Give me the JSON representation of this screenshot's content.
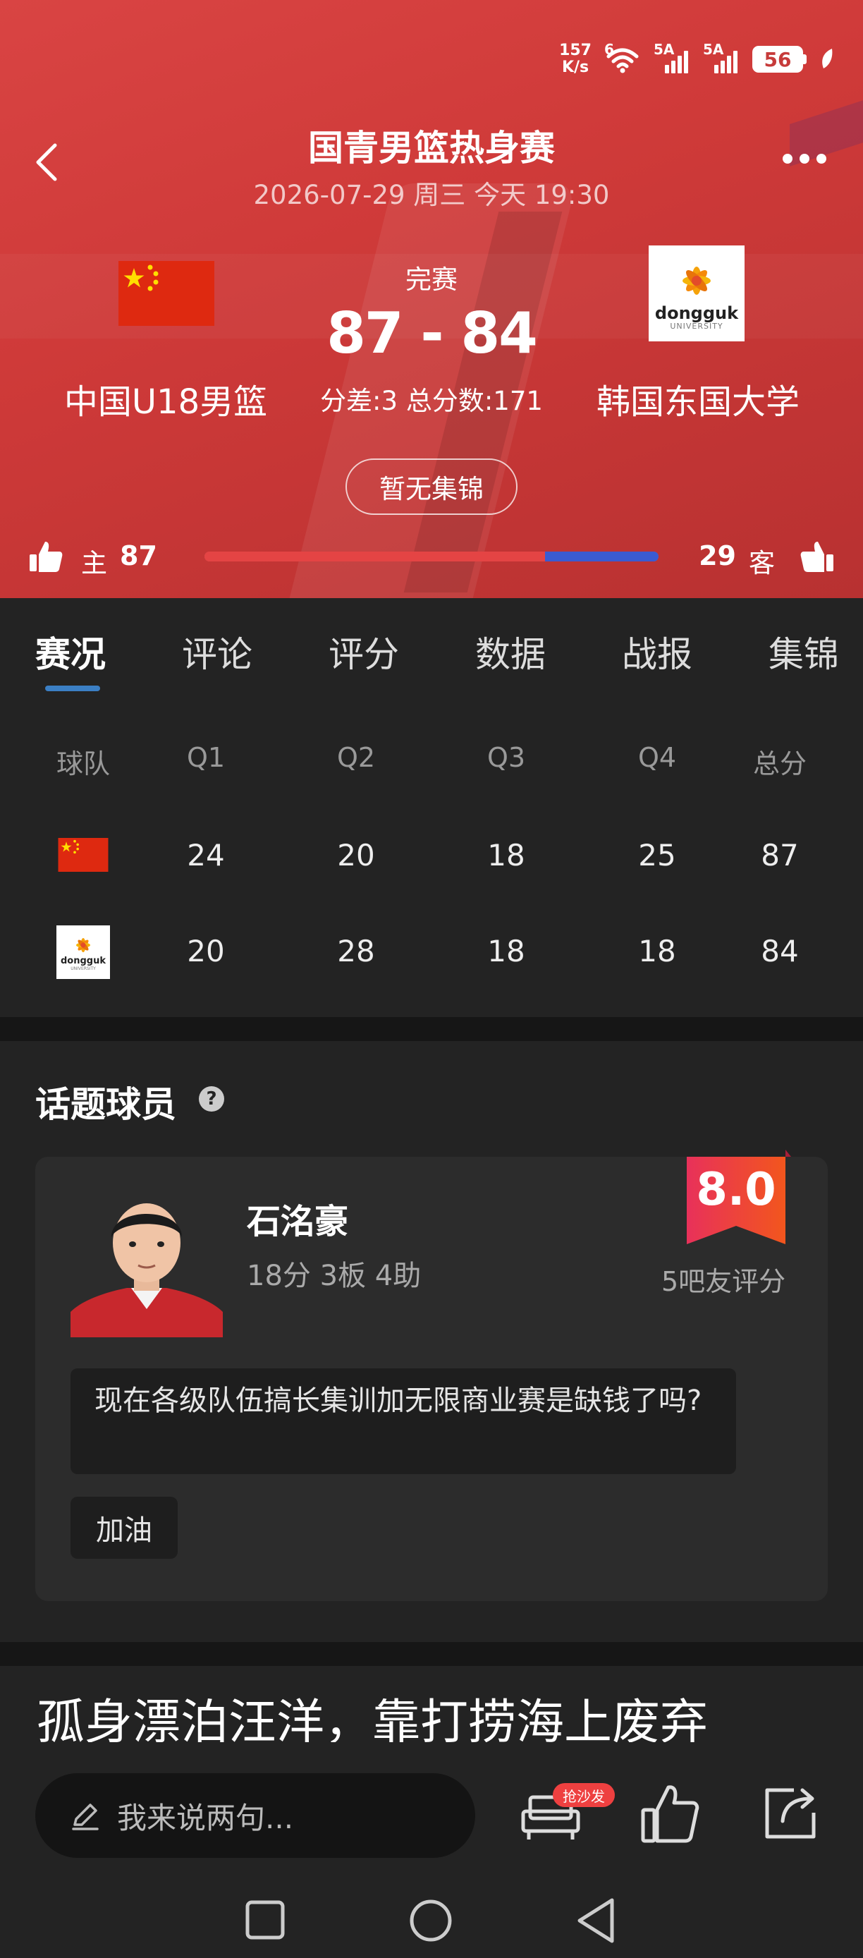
{
  "status_bar": {
    "net_speed_value": "157",
    "net_speed_unit": "K/s",
    "wifi_tag": "6",
    "signal1_tag": "5A",
    "signal2_tag": "5A",
    "battery_level": "56"
  },
  "header": {
    "title": "国青男篮热身赛",
    "datetime": "2026-07-29 周三 今天 19:30",
    "match_status": "完赛",
    "score": "87 - 84",
    "score_detail": "分差:3 总分数:171",
    "home_team": "中国U18男篮",
    "away_team": "韩国东国大学",
    "away_logo_text": "dongguk",
    "away_logo_subtext": "UNIVERSITY",
    "highlight_button": "暂无集锦",
    "accent_color": "#d94443"
  },
  "votes": {
    "home_label": "主",
    "home_count": "87",
    "away_label": "客",
    "away_count": "29",
    "home_share": 0.75,
    "home_color": "#e44444",
    "away_color": "#3a5bd1"
  },
  "tabs": [
    {
      "label": "赛况",
      "active": true
    },
    {
      "label": "评论",
      "active": false
    },
    {
      "label": "评分",
      "active": false
    },
    {
      "label": "数据",
      "active": false
    },
    {
      "label": "战报",
      "active": false
    },
    {
      "label": "集锦",
      "active": false
    }
  ],
  "score_table": {
    "headers": [
      "球队",
      "Q1",
      "Q2",
      "Q3",
      "Q4",
      "总分"
    ],
    "rows": [
      {
        "team": "home",
        "values": [
          "24",
          "20",
          "18",
          "25",
          "87"
        ]
      },
      {
        "team": "away",
        "values": [
          "20",
          "28",
          "18",
          "18",
          "84"
        ]
      }
    ]
  },
  "hot_player": {
    "section_title": "话题球员",
    "help_icon": "question-circle-icon",
    "name": "石洺豪",
    "stats": "18分 3板 4助",
    "rating": "8.0",
    "rating_label": "5吧友评分",
    "comment": "现在各级队伍搞长集训加无限商业赛是缺钱了吗?",
    "cheer": "加油"
  },
  "article": {
    "title": "孤身漂泊汪洋，靠打捞海上废弃"
  },
  "bottom_bar": {
    "comment_placeholder": "我来说两句...",
    "sofa_badge": "抢沙发",
    "icons": [
      "pencil-icon",
      "sofa-icon",
      "like-icon",
      "share-icon"
    ]
  },
  "system_nav": [
    "recent-apps-icon",
    "home-icon",
    "back-icon"
  ]
}
